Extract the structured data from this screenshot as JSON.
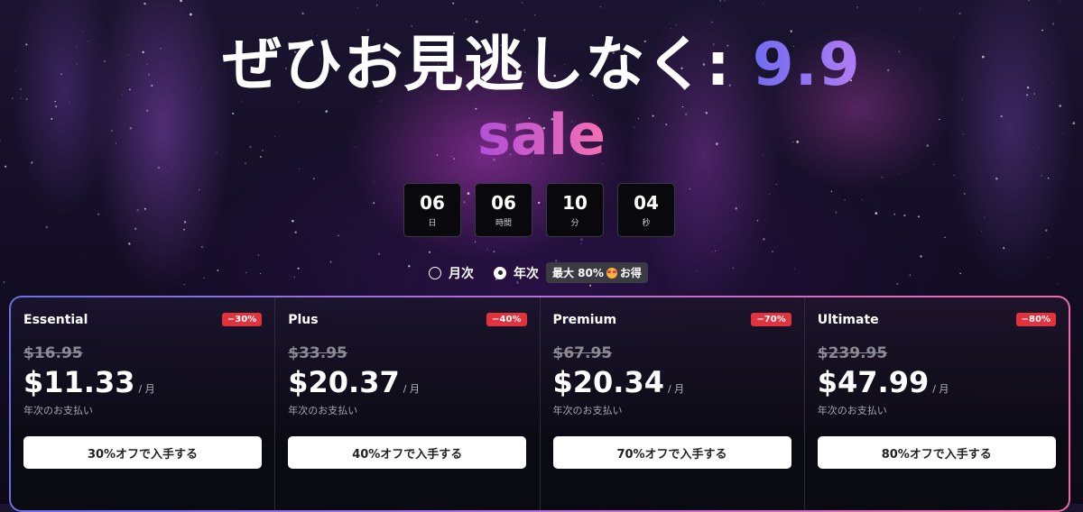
{
  "headline": {
    "text": "ぜひお見逃しなく: ",
    "highlight": "9.9",
    "sale": "sale"
  },
  "countdown": [
    {
      "value": "06",
      "unit": "日"
    },
    {
      "value": "06",
      "unit": "時間"
    },
    {
      "value": "10",
      "unit": "分"
    },
    {
      "value": "04",
      "unit": "秒"
    }
  ],
  "billing_toggle": {
    "monthly_label": "月次",
    "yearly_label": "年次",
    "selected": "yearly",
    "badge": "最大 80%",
    "badge_suffix": "お得",
    "badge_emoji": "star-struck-emoji"
  },
  "plans": [
    {
      "name": "Essential",
      "discount": "−30%",
      "original_price": "$16.95",
      "price": "$11.33",
      "per": "/ 月",
      "billing": "年次のお支払い",
      "cta": "30%オフで入手する"
    },
    {
      "name": "Plus",
      "discount": "−40%",
      "original_price": "$33.95",
      "price": "$20.37",
      "per": "/ 月",
      "billing": "年次のお支払い",
      "cta": "40%オフで入手する"
    },
    {
      "name": "Premium",
      "discount": "−70%",
      "original_price": "$67.95",
      "price": "$20.34",
      "per": "/ 月",
      "billing": "年次のお支払い",
      "cta": "70%オフで入手する"
    },
    {
      "name": "Ultimate",
      "discount": "−80%",
      "original_price": "$239.95",
      "price": "$47.99",
      "per": "/ 月",
      "billing": "年次のお支払い",
      "cta": "80%オフで入手する"
    }
  ],
  "colors": {
    "accent_gradient_start": "#6c6fe6",
    "accent_gradient_end": "#f06aa6",
    "discount_badge": "#e2323e",
    "cta_background": "#ffffff"
  }
}
